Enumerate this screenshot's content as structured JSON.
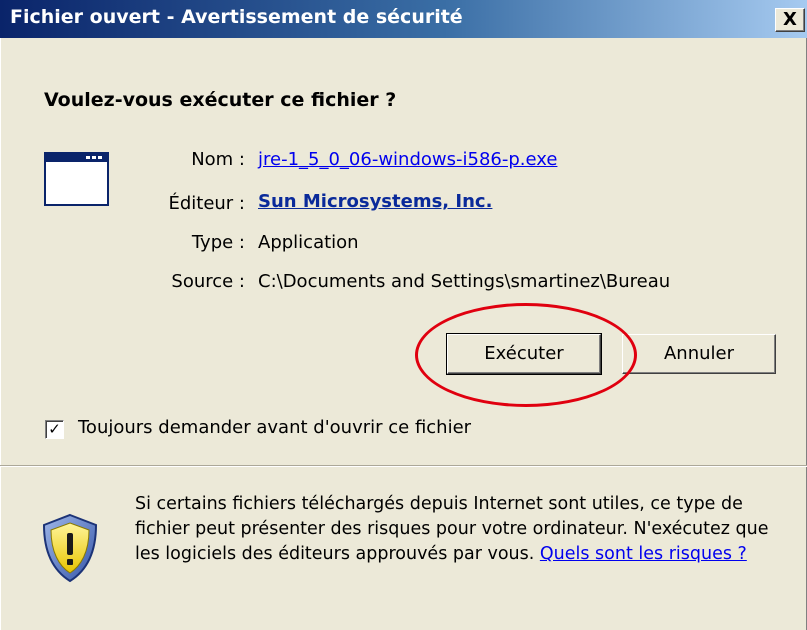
{
  "window": {
    "title": "Fichier ouvert - Avertissement de sécurité",
    "close_label": "X"
  },
  "prompt": {
    "heading": "Voulez-vous exécuter ce fichier ?"
  },
  "file_info": {
    "name_label": "Nom :",
    "name_value": "jre-1_5_0_06-windows-i586-p.exe",
    "publisher_label": "Éditeur :",
    "publisher_value": "Sun Microsystems, Inc.",
    "type_label": "Type :",
    "type_value": "Application",
    "source_label": "Source :",
    "source_value": "C:\\Documents and Settings\\smartinez\\Bureau"
  },
  "buttons": {
    "run": "Exécuter",
    "cancel": "Annuler"
  },
  "options": {
    "always_ask_label": "Toujours demander avant d'ouvrir ce fichier",
    "always_ask_checked": true,
    "check_mark": "✓"
  },
  "warning": {
    "text": "Si certains fichiers téléchargés depuis Internet sont utiles, ce type de fichier peut présenter des risques pour votre ordinateur. N'exécutez que les logiciels des éditeurs approuvés par vous. ",
    "link_text": "Quels sont les risques ?"
  },
  "annotation": {
    "highlight_color": "#e0000f"
  },
  "colors": {
    "titlebar": "#0a246a",
    "dialog_bg": "#ece9d8",
    "link": "#0000ee"
  },
  "icons": {
    "app": "application-window-icon",
    "shield": "security-shield-icon"
  }
}
